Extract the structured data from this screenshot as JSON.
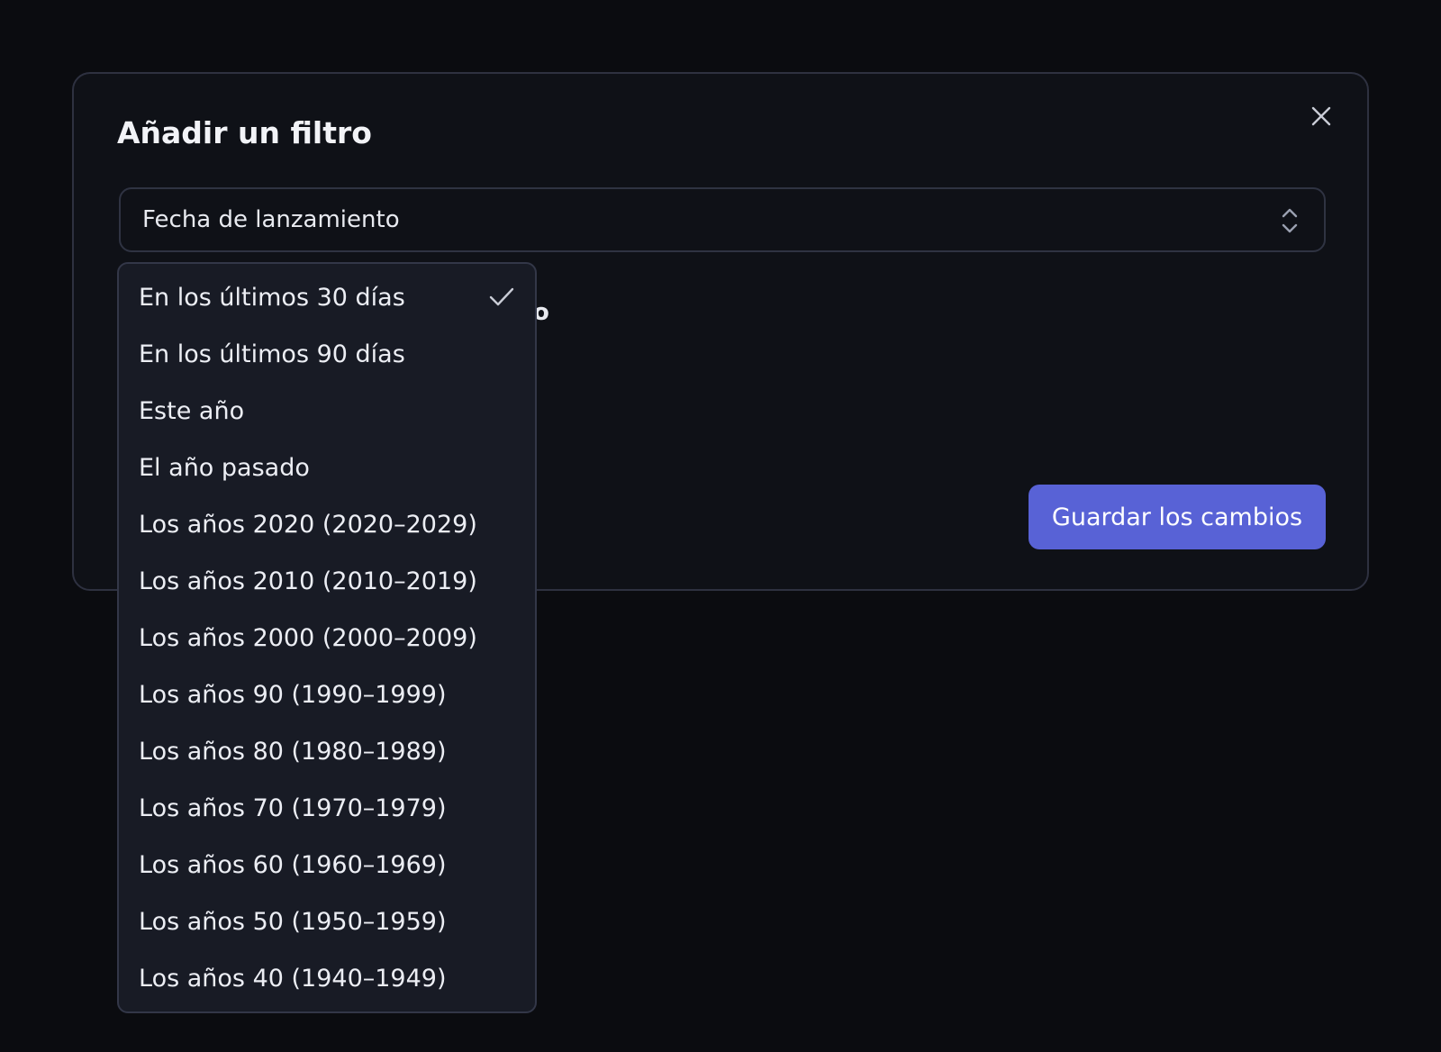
{
  "modal": {
    "title": "Añadir un filtro",
    "close_icon": "close-icon"
  },
  "field_select": {
    "value": "Fecha de lanzamiento",
    "icon": "chevron-up-down-icon"
  },
  "peek_text": "o",
  "save_button": {
    "label": "Guardar los cambios"
  },
  "colors": {
    "background": "#0b0c10",
    "modal": "#0f1117",
    "dropdown": "#181b25",
    "accent": "#5862d6"
  },
  "dropdown": {
    "selected_index": 0,
    "check_icon": "check-icon",
    "options": [
      "En los últimos 30 días",
      "En los últimos 90 días",
      "Este año",
      "El año pasado",
      "Los años 2020 (2020–2029)",
      "Los años 2010 (2010–2019)",
      "Los años 2000 (2000–2009)",
      "Los años 90 (1990–1999)",
      "Los años 80 (1980–1989)",
      "Los años 70 (1970–1979)",
      "Los años 60 (1960–1969)",
      "Los años 50 (1950–1959)",
      "Los años 40 (1940–1949)"
    ]
  }
}
